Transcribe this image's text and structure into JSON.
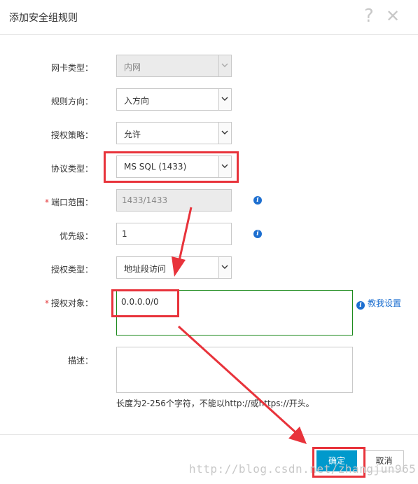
{
  "dialog": {
    "title": "添加安全组规则",
    "help_icon": "question-icon",
    "close_icon": "close-icon"
  },
  "form": {
    "nic_type": {
      "label": "网卡类型：",
      "value": "内网",
      "disabled": true
    },
    "direction": {
      "label": "规则方向：",
      "value": "入方向"
    },
    "policy": {
      "label": "授权策略：",
      "value": "允许"
    },
    "protocol": {
      "label": "协议类型：",
      "value": "MS SQL (1433)"
    },
    "port_range": {
      "label": "端口范围：",
      "value": "1433/1433",
      "required": true,
      "disabled": true
    },
    "priority": {
      "label": "优先级：",
      "value": "1"
    },
    "auth_type": {
      "label": "授权类型：",
      "value": "地址段访问"
    },
    "auth_object": {
      "label": "授权对象：",
      "value": "0.0.0.0/0",
      "required": true
    },
    "teach_link": "教我设置",
    "description": {
      "label": "描述：",
      "value": ""
    },
    "hint": "长度为2-256个字符，不能以http://或https://开头。"
  },
  "footer": {
    "ok_label": "确定",
    "cancel_label": "取消"
  },
  "watermark": "http://blog.csdn.net/zhangjun965",
  "colors": {
    "primary": "#0099cc",
    "annotation_red": "#e8333b",
    "link_blue": "#1d6fd0",
    "focus_green": "#1d8a1d"
  }
}
